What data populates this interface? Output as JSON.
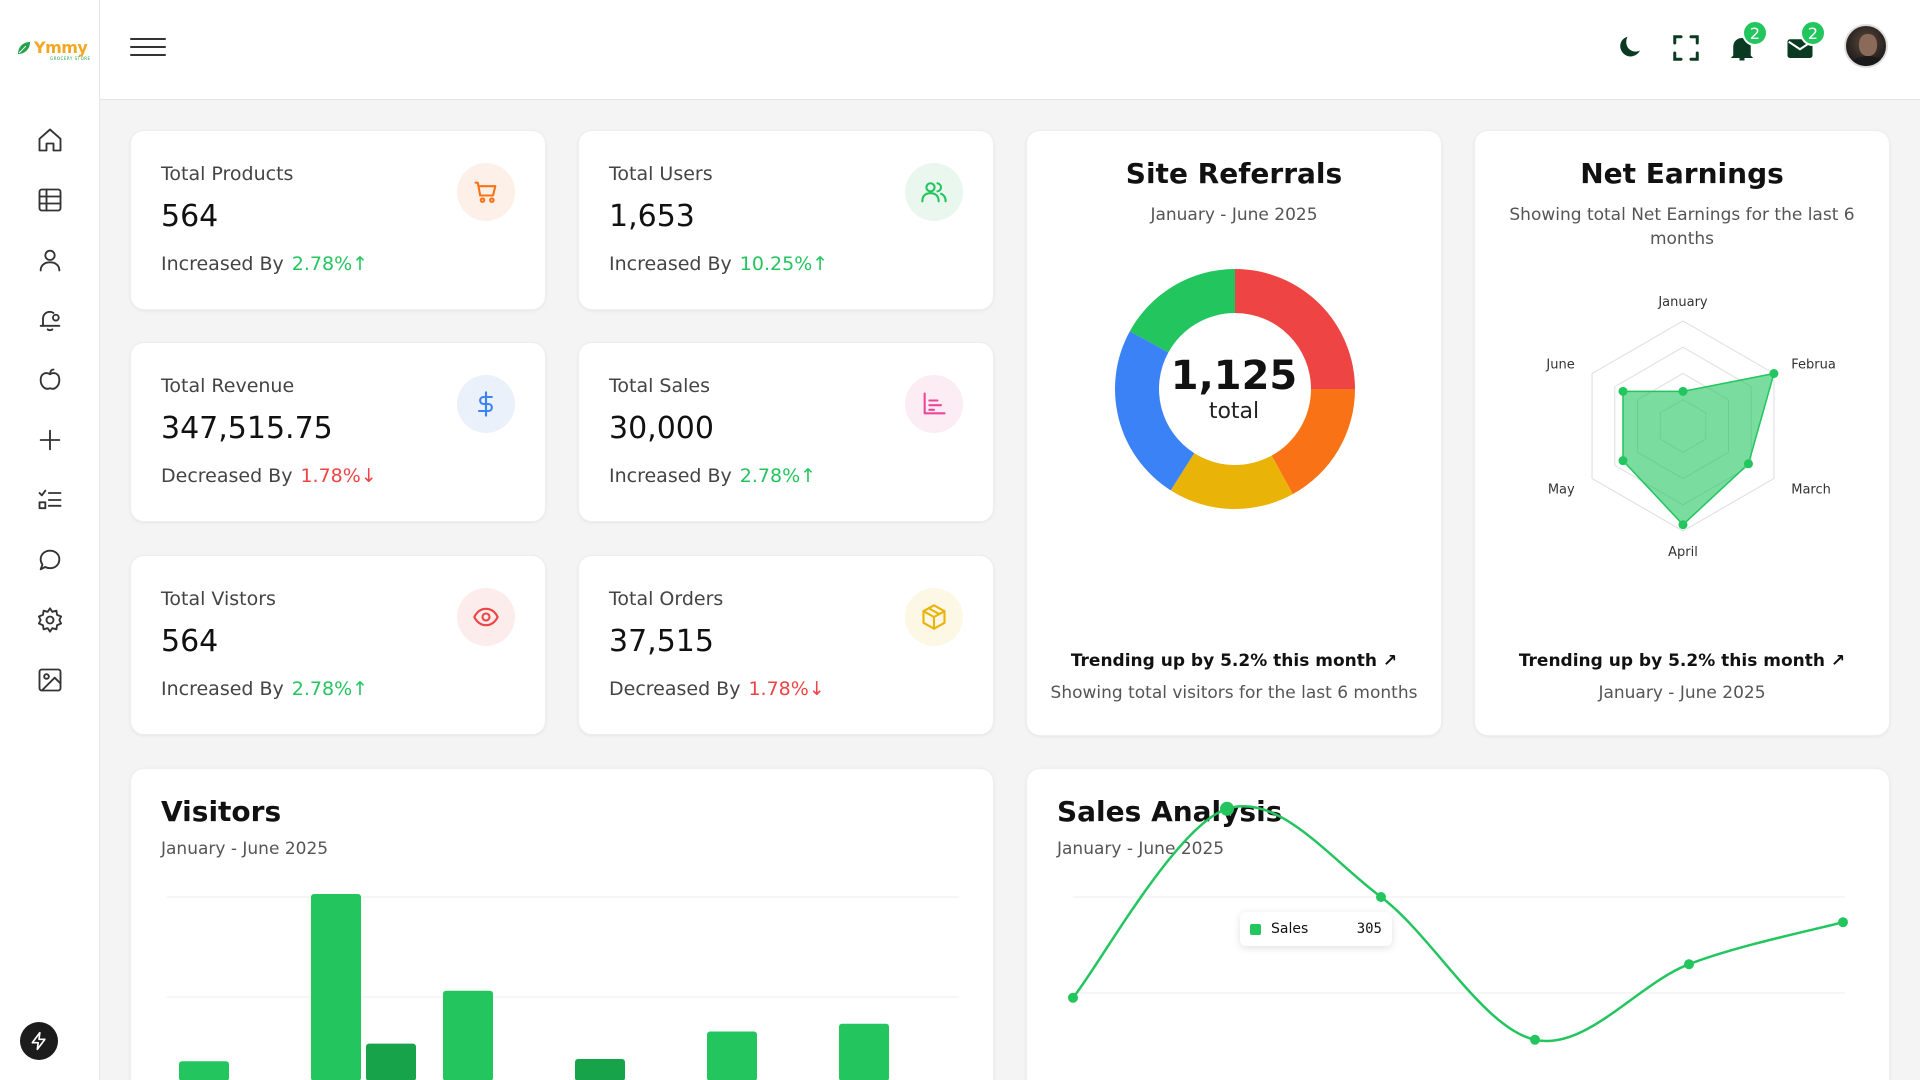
{
  "brand": {
    "name_a": "Ymmy",
    "tagline": "GROCERY STORE"
  },
  "sidebar": {
    "items": [
      {
        "name": "home-icon"
      },
      {
        "name": "table-icon"
      },
      {
        "name": "user-icon"
      },
      {
        "name": "bell-settings-icon"
      },
      {
        "name": "apple-icon"
      },
      {
        "name": "plus-icon"
      },
      {
        "name": "checklist-icon"
      },
      {
        "name": "chat-icon"
      },
      {
        "name": "gear-icon"
      },
      {
        "name": "image-icon"
      }
    ]
  },
  "header": {
    "notifications_count": "2",
    "messages_count": "2"
  },
  "stats": [
    {
      "label": "Total Products",
      "value": "564",
      "change_text": "Increased By",
      "change_pct": "2.78%",
      "arrow": "↑",
      "dir": "up",
      "icon": "cart-icon",
      "icon_color": "#f97316",
      "icon_bg": "#fdf0e8"
    },
    {
      "label": "Total Users",
      "value": "1,653",
      "change_text": "Increased By",
      "change_pct": "10.25%",
      "arrow": "↑",
      "dir": "up",
      "icon": "users-icon",
      "icon_color": "#22c55e",
      "icon_bg": "#eaf7ef"
    },
    {
      "label": "Total Revenue",
      "value": "347,515.75",
      "change_text": "Decreased By",
      "change_pct": "1.78%",
      "arrow": "↓",
      "dir": "down",
      "icon": "dollar-icon",
      "icon_color": "#3b82f6",
      "icon_bg": "#eaf1fb"
    },
    {
      "label": "Total Sales",
      "value": "30,000",
      "change_text": "Increased By",
      "change_pct": "2.78%",
      "arrow": "↑",
      "dir": "up",
      "icon": "bar-chart-icon",
      "icon_color": "#ec4899",
      "icon_bg": "#fcecf4"
    },
    {
      "label": "Total Vistors",
      "value": "564",
      "change_text": "Increased By",
      "change_pct": "2.78%",
      "arrow": "↑",
      "dir": "up",
      "icon": "eye-icon",
      "icon_color": "#ef4444",
      "icon_bg": "#fdecec"
    },
    {
      "label": "Total Orders",
      "value": "37,515",
      "change_text": "Decreased By",
      "change_pct": "1.78%",
      "arrow": "↓",
      "dir": "down",
      "icon": "box-icon",
      "icon_color": "#eab308",
      "icon_bg": "#fdf7e6"
    }
  ],
  "referrals": {
    "title": "Site Referrals",
    "subtitle": "January - June 2025",
    "total": "1,125",
    "total_label": "total",
    "trend": "Trending up by 5.2% this month",
    "trend_sub": "Showing total visitors for the last 6 months"
  },
  "earnings": {
    "title": "Net Earnings",
    "subtitle": "Showing total Net Earnings for the last 6 months",
    "trend": "Trending up by 5.2% this month",
    "trend_sub": "January - June 2025"
  },
  "visitors": {
    "title": "Visitors",
    "subtitle": "January - June 2025"
  },
  "sales": {
    "title": "Sales Analysis",
    "subtitle": "January - June 2025",
    "tooltip_label": "Sales",
    "tooltip_value": "305"
  },
  "colors": {
    "green": "#22c55e",
    "red": "#ef4444",
    "orange": "#f97316",
    "yellow": "#eab308",
    "blue": "#3b82f6"
  },
  "chart_data": [
    {
      "type": "pie",
      "title": "Site Referrals",
      "center_value": 1125,
      "slices": [
        {
          "color": "#ef4444",
          "value": 0.25
        },
        {
          "color": "#f97316",
          "value": 0.17
        },
        {
          "color": "#eab308",
          "value": 0.17
        },
        {
          "color": "#3b82f6",
          "value": 0.24
        },
        {
          "color": "#22c55e",
          "value": 0.17
        }
      ]
    },
    {
      "type": "radar",
      "title": "Net Earnings",
      "categories": [
        "January",
        "Februa",
        "March",
        "April",
        "May",
        "June"
      ],
      "values": [
        0.33,
        1.0,
        0.72,
        0.94,
        0.66,
        0.66
      ],
      "max": 1.0
    },
    {
      "type": "bar",
      "title": "Visitors",
      "series": [
        {
          "color": "#22c55e",
          "values": [
            18,
            170,
            82,
            null,
            45,
            52
          ]
        },
        {
          "color": "#16a34a",
          "values": [
            null,
            34,
            null,
            20,
            null,
            null
          ]
        }
      ]
    },
    {
      "type": "line",
      "title": "Sales Analysis",
      "x": [
        0,
        1,
        2,
        3,
        4,
        5
      ],
      "values": [
        80,
        305,
        200,
        30,
        120,
        170
      ],
      "highlight_index": 1
    }
  ]
}
